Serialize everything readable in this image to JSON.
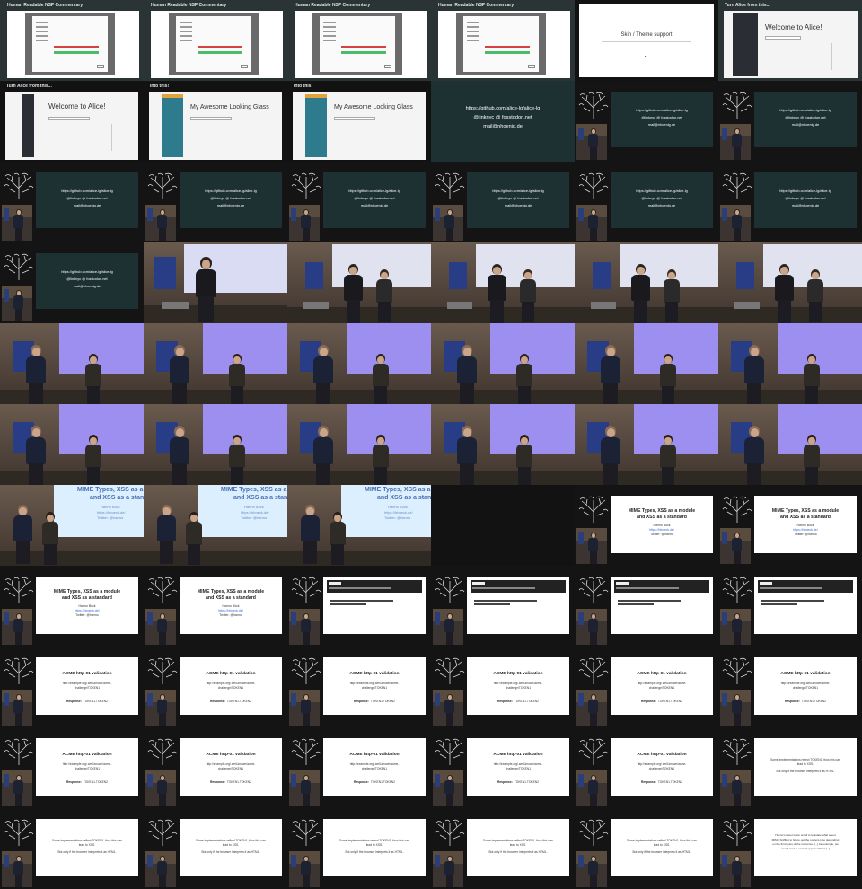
{
  "grid": {
    "columns": 6,
    "rows": 11,
    "background": "#121212"
  },
  "text": {
    "nsp_title": "Human Readable NSP Commentary",
    "skin_title": "Skin / Theme support",
    "turn_title": "Turn Alice from this...",
    "into_this": "Into this!",
    "welcome": "Welcome to Alice!",
    "looking_glass": "My Awesome Looking Glass",
    "contact_github": "https://github.com/alice-lg/alice-lg",
    "contact_mastodon": "@linknyc @ fosstodon.net",
    "contact_mail": "mail@nhoenig.de",
    "mime_title_1": "MIME Types, XSS as a module",
    "mime_title_2": "and XSS as a standard",
    "mime_author": "Hanno Böck",
    "mime_site": "https://hboeck.de/",
    "mime_twitter": "Twitter: @hanno",
    "acme_title": "ACME http-01 validation",
    "acme_url_1": "http://example.org/.well-known/acme-",
    "acme_url_2": "challenge/TOKEN1",
    "acme_response_label": "Response:",
    "acme_response_value": "TOKEN1.TOKEN2",
    "some_impl_1": "Some implementations reflect TOKEN1, thus this can",
    "some_impl_2": "lead to XSS.",
    "some_impl_3": "But only if the browser interprets it as HTML.",
    "last_1": "Hanno's tweet is too small to legislate what about",
    "last_2": "MIME Sniffing to figure out the content-type depending",
    "last_3": "on the first bytes of the response. [...] for example, we",
    "last_4": "would tend to content-type text/html [...]"
  },
  "colors": {
    "dark_teal": "#1e3132",
    "white_slide": "#ffffff",
    "projection_purple": "#9d8ff0",
    "brick": "#5a4b3f",
    "sidebar_teal": "#2d7b8c",
    "alert_red": "#d44242",
    "ok_green": "#4cbb6c"
  },
  "tiles": [
    {
      "r": 0,
      "c": 0,
      "t": "nsp"
    },
    {
      "r": 0,
      "c": 1,
      "t": "nsp"
    },
    {
      "r": 0,
      "c": 2,
      "t": "nsp"
    },
    {
      "r": 0,
      "c": 3,
      "t": "nsp"
    },
    {
      "r": 0,
      "c": 4,
      "t": "skin"
    },
    {
      "r": 0,
      "c": 5,
      "t": "turn_alice"
    },
    {
      "r": 1,
      "c": 0,
      "t": "welcome"
    },
    {
      "r": 1,
      "c": 1,
      "t": "glass"
    },
    {
      "r": 1,
      "c": 2,
      "t": "glass"
    },
    {
      "r": 1,
      "c": 3,
      "t": "contact"
    },
    {
      "r": 1,
      "c": 4,
      "t": "cam_contact"
    },
    {
      "r": 1,
      "c": 5,
      "t": "cam_contact"
    },
    {
      "r": 2,
      "c": 0,
      "t": "cam_contact"
    },
    {
      "r": 2,
      "c": 1,
      "t": "cam_contact"
    },
    {
      "r": 2,
      "c": 2,
      "t": "cam_contact"
    },
    {
      "r": 2,
      "c": 3,
      "t": "cam_contact"
    },
    {
      "r": 2,
      "c": 4,
      "t": "cam_contact"
    },
    {
      "r": 2,
      "c": 5,
      "t": "cam_contact"
    },
    {
      "r": 3,
      "c": 0,
      "t": "cam_contact"
    },
    {
      "r": 3,
      "c": 1,
      "t": "stage_mic"
    },
    {
      "r": 3,
      "c": 2,
      "t": "stage_two"
    },
    {
      "r": 3,
      "c": 3,
      "t": "stage_two"
    },
    {
      "r": 3,
      "c": 4,
      "t": "stage_two"
    },
    {
      "r": 3,
      "c": 5,
      "t": "stage_two"
    },
    {
      "r": 4,
      "c": 0,
      "t": "purple"
    },
    {
      "r": 4,
      "c": 1,
      "t": "purple"
    },
    {
      "r": 4,
      "c": 2,
      "t": "purple"
    },
    {
      "r": 4,
      "c": 3,
      "t": "purple"
    },
    {
      "r": 4,
      "c": 4,
      "t": "purple"
    },
    {
      "r": 4,
      "c": 5,
      "t": "purple"
    },
    {
      "r": 5,
      "c": 0,
      "t": "purple"
    },
    {
      "r": 5,
      "c": 1,
      "t": "purple"
    },
    {
      "r": 5,
      "c": 2,
      "t": "purple"
    },
    {
      "r": 5,
      "c": 3,
      "t": "purple"
    },
    {
      "r": 5,
      "c": 4,
      "t": "purple"
    },
    {
      "r": 5,
      "c": 5,
      "t": "purple"
    },
    {
      "r": 6,
      "c": 0,
      "t": "mime_stage"
    },
    {
      "r": 6,
      "c": 1,
      "t": "mime_stage"
    },
    {
      "r": 6,
      "c": 2,
      "t": "mime_stage"
    },
    {
      "r": 6,
      "c": 3,
      "t": "blank"
    },
    {
      "r": 6,
      "c": 4,
      "t": "mime_cam"
    },
    {
      "r": 6,
      "c": 5,
      "t": "mime_cam"
    },
    {
      "r": 7,
      "c": 0,
      "t": "mime_cam"
    },
    {
      "r": 7,
      "c": 1,
      "t": "mime_cam"
    },
    {
      "r": 7,
      "c": 2,
      "t": "terminal"
    },
    {
      "r": 7,
      "c": 3,
      "t": "terminal"
    },
    {
      "r": 7,
      "c": 4,
      "t": "terminal"
    },
    {
      "r": 7,
      "c": 5,
      "t": "terminal"
    },
    {
      "r": 8,
      "c": 0,
      "t": "acme"
    },
    {
      "r": 8,
      "c": 1,
      "t": "acme"
    },
    {
      "r": 8,
      "c": 2,
      "t": "acme"
    },
    {
      "r": 8,
      "c": 3,
      "t": "acme"
    },
    {
      "r": 8,
      "c": 4,
      "t": "acme"
    },
    {
      "r": 8,
      "c": 5,
      "t": "acme"
    },
    {
      "r": 9,
      "c": 0,
      "t": "acme"
    },
    {
      "r": 9,
      "c": 1,
      "t": "acme"
    },
    {
      "r": 9,
      "c": 2,
      "t": "acme"
    },
    {
      "r": 9,
      "c": 3,
      "t": "acme"
    },
    {
      "r": 9,
      "c": 4,
      "t": "acme"
    },
    {
      "r": 9,
      "c": 5,
      "t": "some_impl"
    },
    {
      "r": 10,
      "c": 0,
      "t": "some_impl"
    },
    {
      "r": 10,
      "c": 1,
      "t": "some_impl"
    },
    {
      "r": 10,
      "c": 2,
      "t": "some_impl"
    },
    {
      "r": 10,
      "c": 3,
      "t": "some_impl"
    },
    {
      "r": 10,
      "c": 4,
      "t": "some_impl"
    },
    {
      "r": 10,
      "c": 5,
      "t": "last"
    }
  ]
}
